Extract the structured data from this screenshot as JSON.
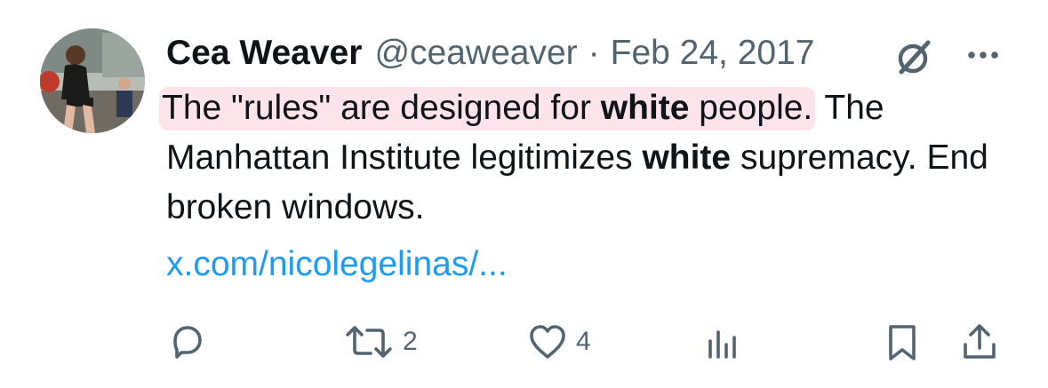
{
  "tweet": {
    "author_name": "Cea Weaver",
    "handle": "@ceaweaver",
    "separator": "·",
    "date": "Feb 24, 2017",
    "text_part1": "The \"rules\" are designed for ",
    "text_bold1": "white",
    "text_part2": " people.",
    "text_part3": " The Manhattan Institute legitimizes ",
    "text_bold2": "white",
    "text_part4": " supremacy. End broken windows.",
    "link": "x.com/nicolegelinas/..."
  },
  "actions": {
    "reply_count": "",
    "retweet_count": "2",
    "like_count": "4",
    "views_count": ""
  },
  "colors": {
    "text": "#0f1419",
    "muted": "#536471",
    "link": "#1d9bf0",
    "highlight": "#fde4ea"
  },
  "icons": [
    "reply-icon",
    "retweet-icon",
    "like-icon",
    "views-icon",
    "bookmark-icon",
    "share-icon",
    "grok-icon",
    "more-icon"
  ]
}
